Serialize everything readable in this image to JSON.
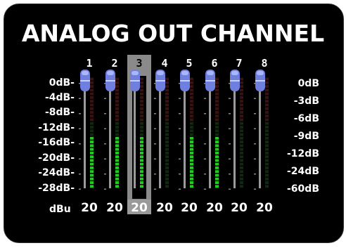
{
  "title": "ANALOG OUT CHANNEL",
  "selected_channel_index": 2,
  "channels": [
    {
      "number": "1",
      "value": "20",
      "level_fraction": 0.45
    },
    {
      "number": "2",
      "value": "20",
      "level_fraction": 0.45
    },
    {
      "number": "3",
      "value": "20",
      "level_fraction": 0.45
    },
    {
      "number": "4",
      "value": "20",
      "level_fraction": 0.0
    },
    {
      "number": "5",
      "value": "20",
      "level_fraction": 0.45
    },
    {
      "number": "6",
      "value": "20",
      "level_fraction": 0.45
    },
    {
      "number": "7",
      "value": "20",
      "level_fraction": 0.0
    },
    {
      "number": "8",
      "value": "20",
      "level_fraction": 0.0
    }
  ],
  "fader_scale": [
    "0dB-",
    "-4dB-",
    "-8dB-",
    "-12dB-",
    "-16dB-",
    "-20dB-",
    "-24dB-",
    "-28dB-"
  ],
  "meter_scale": [
    "0dB",
    "-3dB",
    "-6dB",
    "-9dB",
    "-12dB",
    "-24dB",
    "-60dB"
  ],
  "unit_label": "dBu",
  "colors": {
    "background": "#000000",
    "fader_knob": "#6f7fe0",
    "meter_green": "#1fd01f",
    "meter_dim_red": "#3a1212",
    "meter_dim_green": "#0f2a0f",
    "selection": "#8a8a8a"
  }
}
